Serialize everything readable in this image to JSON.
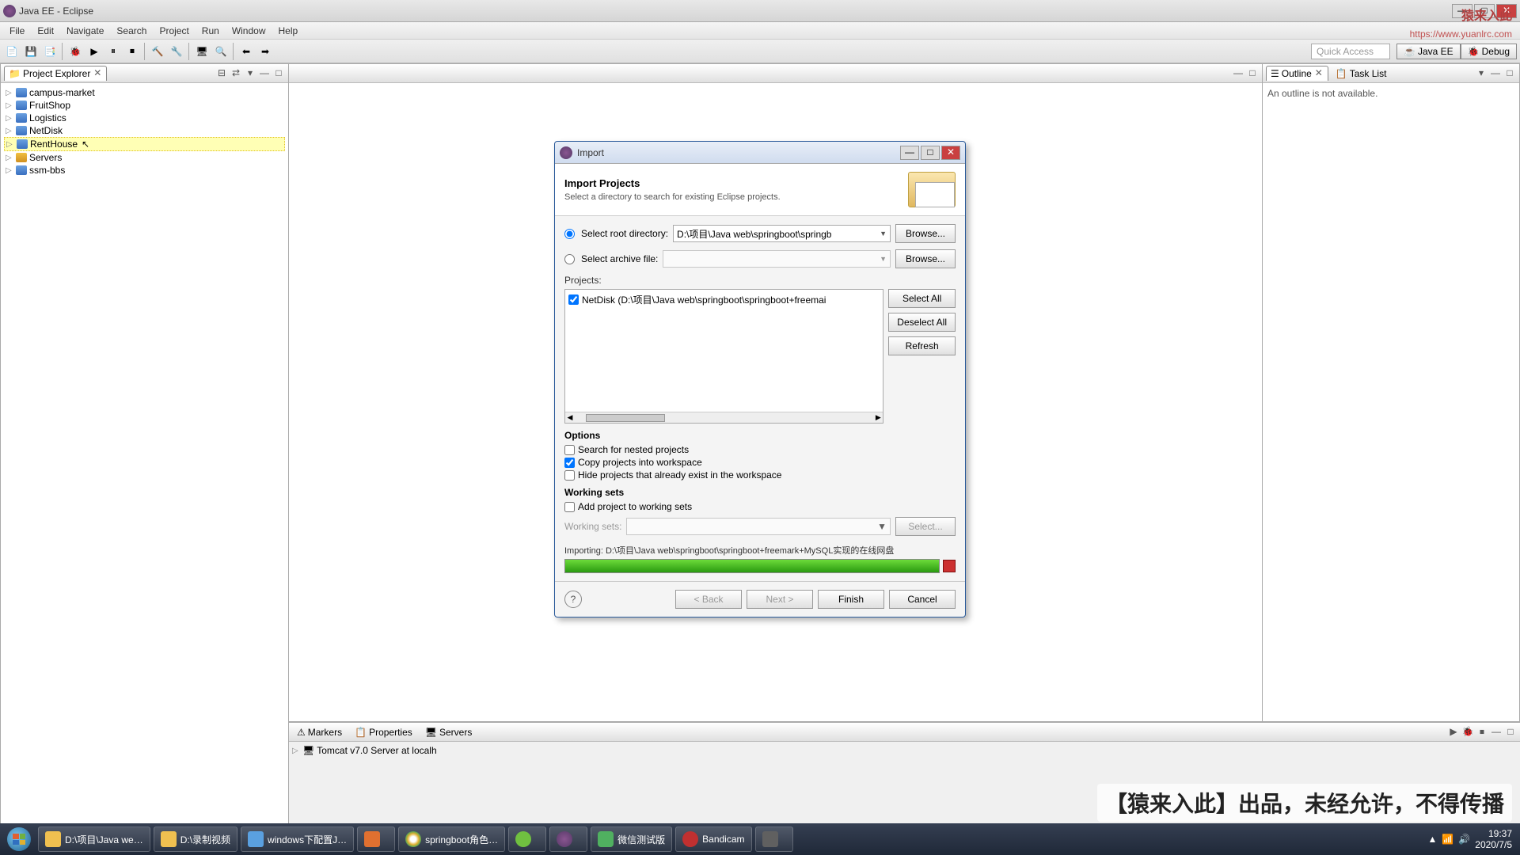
{
  "window": {
    "title": "Java EE - Eclipse"
  },
  "menu": [
    "File",
    "Edit",
    "Navigate",
    "Search",
    "Project",
    "Run",
    "Window",
    "Help"
  ],
  "quick_access": "Quick Access",
  "perspectives": [
    "Java EE",
    "Debug"
  ],
  "project_explorer": {
    "title": "Project Explorer",
    "items": [
      "campus-market",
      "FruitShop",
      "Logistics",
      "NetDisk",
      "RentHouse",
      "Servers",
      "ssm-bbs"
    ],
    "highlighted_index": 4
  },
  "outline": {
    "title": "Outline",
    "tasklist": "Task List",
    "message": "An outline is not available."
  },
  "bottom_tabs": [
    "Markers",
    "Properties",
    "Servers"
  ],
  "server_item": "Tomcat v7.0 Server at localh",
  "dialog": {
    "title": "Import",
    "heading": "Import Projects",
    "description": "Select a directory to search for existing Eclipse projects.",
    "root_label": "Select root directory:",
    "root_value": "D:\\项目\\Java web\\springboot\\springb",
    "archive_label": "Select archive file:",
    "browse": "Browse...",
    "projects_label": "Projects:",
    "project_item": "NetDisk (D:\\项目\\Java web\\springboot\\springboot+freemai",
    "select_all": "Select All",
    "deselect_all": "Deselect All",
    "refresh": "Refresh",
    "options": "Options",
    "opt_nested": "Search for nested projects",
    "opt_copy": "Copy projects into workspace",
    "opt_hide": "Hide projects that already exist in the workspace",
    "working_sets": "Working sets",
    "ws_add": "Add project to working sets",
    "ws_label": "Working sets:",
    "ws_select": "Select...",
    "progress_label": "Importing: D:\\项目\\Java web\\springboot\\springboot+freemark+MySQL实现的在线网盘",
    "back": "< Back",
    "next": "Next >",
    "finish": "Finish",
    "cancel": "Cancel"
  },
  "taskbar": {
    "items": [
      {
        "label": "D:\\项目\\Java we…",
        "color": "#f0c050"
      },
      {
        "label": "D:\\录制视频",
        "color": "#f0c050"
      },
      {
        "label": "windows下配置J…",
        "color": "#5aa0e0"
      },
      {
        "label": "",
        "color": "#e07030"
      },
      {
        "label": "springboot角色…",
        "color": "#30a060"
      },
      {
        "label": "",
        "color": "#70c040"
      },
      {
        "label": "",
        "color": "#563a68"
      },
      {
        "label": "微信测试版",
        "color": "#50b060"
      },
      {
        "label": "Bandicam",
        "color": "#c03030"
      },
      {
        "label": "",
        "color": "#606060"
      }
    ],
    "time": "19:37",
    "date": "2020/7/5"
  },
  "watermark": "【猿来入此】出品，未经允许，不得传播",
  "brand": "猿来入此",
  "brand_url": "https://www.yuanlrc.com"
}
